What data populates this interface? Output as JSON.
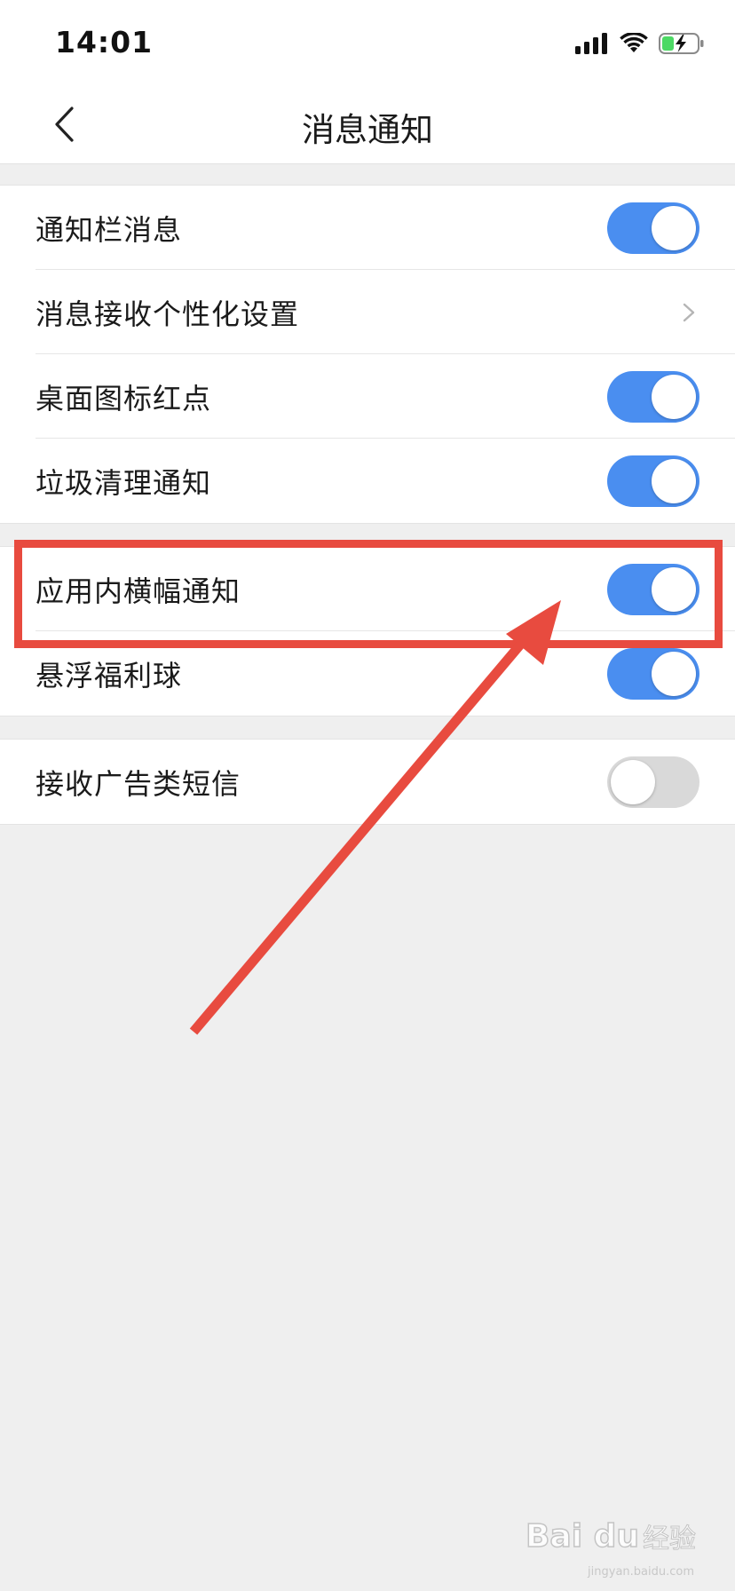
{
  "status_bar": {
    "time": "14:01",
    "signal_icon": "cellular-signal-icon",
    "wifi_icon": "wifi-icon",
    "battery_icon": "battery-charging-icon"
  },
  "nav": {
    "back_icon": "chevron-left-icon",
    "title": "消息通知"
  },
  "groups": [
    {
      "rows": [
        {
          "label": "通知栏消息",
          "control": "toggle",
          "on": true
        },
        {
          "label": "消息接收个性化设置",
          "control": "chevron"
        },
        {
          "label": "桌面图标红点",
          "control": "toggle",
          "on": true
        },
        {
          "label": "垃圾清理通知",
          "control": "toggle",
          "on": true
        }
      ]
    },
    {
      "rows": [
        {
          "label": "应用内横幅通知",
          "control": "toggle",
          "on": true
        },
        {
          "label": "悬浮福利球",
          "control": "toggle",
          "on": true
        }
      ]
    },
    {
      "rows": [
        {
          "label": "接收广告类短信",
          "control": "toggle",
          "on": false
        }
      ]
    }
  ],
  "colors": {
    "toggle_on": "#4a8ef0",
    "toggle_off": "#d9d9d9",
    "annotation": "#e84b3f",
    "page_background": "#efefef"
  },
  "watermark": {
    "logo": "Bai du",
    "text": "经验",
    "url": "jingyan.baidu.com"
  }
}
